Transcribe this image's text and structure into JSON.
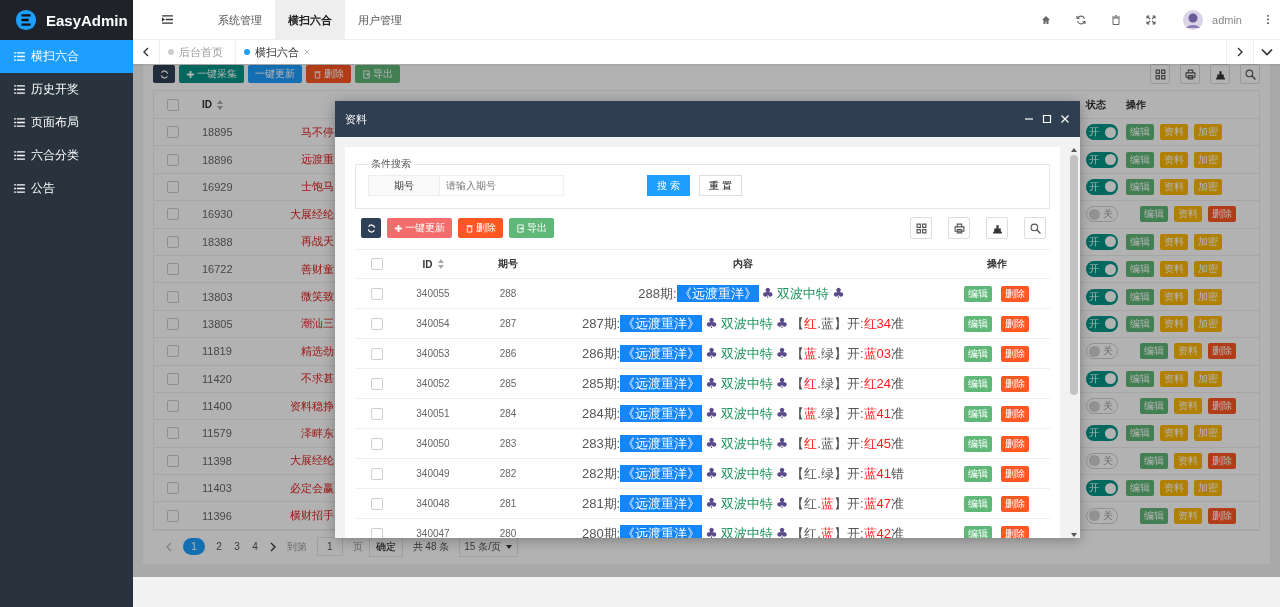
{
  "app": {
    "name": "EasyAdmin"
  },
  "top_menu": [
    {
      "label": "系统管理",
      "selected": false
    },
    {
      "label": "横扫六合",
      "selected": true
    },
    {
      "label": "用户管理",
      "selected": false
    }
  ],
  "user": {
    "name": "admin"
  },
  "sidebar": {
    "items": [
      {
        "label": "横扫六合",
        "selected": true
      },
      {
        "label": "历史开奖",
        "selected": false
      },
      {
        "label": "页面布局",
        "selected": false
      },
      {
        "label": "六合分类",
        "selected": false
      },
      {
        "label": "公告",
        "selected": false
      }
    ]
  },
  "page_tabs": [
    {
      "label": "后台首页",
      "selected": false,
      "closable": false
    },
    {
      "label": "横扫六合",
      "selected": true,
      "closable": true
    }
  ],
  "toolbar": [
    {
      "label": "一键采集",
      "kind": "add"
    },
    {
      "label": "一键更新",
      "kind": "update"
    },
    {
      "label": "删除",
      "kind": "delete"
    },
    {
      "label": "导出",
      "kind": "export"
    }
  ],
  "table": {
    "columns": [
      "ID",
      "状态",
      "操作"
    ],
    "all_checked": false,
    "rows": [
      {
        "checked": false,
        "id": "18895",
        "title": "马不停",
        "on": true,
        "switch_label": "开",
        "actions": [
          {
            "label": "编辑",
            "kind": "edit"
          },
          {
            "label": "资料",
            "kind": "info"
          },
          {
            "label": "加密",
            "kind": "info"
          }
        ]
      },
      {
        "checked": false,
        "id": "18896",
        "title": "远渡重",
        "on": true,
        "switch_label": "开",
        "actions": [
          {
            "label": "编辑",
            "kind": "edit"
          },
          {
            "label": "资料",
            "kind": "info"
          },
          {
            "label": "加密",
            "kind": "info"
          }
        ]
      },
      {
        "checked": false,
        "id": "16929",
        "title": "士饱马",
        "on": true,
        "switch_label": "开",
        "actions": [
          {
            "label": "编辑",
            "kind": "edit"
          },
          {
            "label": "资料",
            "kind": "info"
          },
          {
            "label": "加密",
            "kind": "info"
          }
        ]
      },
      {
        "checked": false,
        "id": "16930",
        "title": "大展经纶",
        "on": false,
        "switch_label": "关",
        "actions": [
          {
            "label": "编辑",
            "kind": "edit"
          },
          {
            "label": "资料",
            "kind": "info"
          },
          {
            "label": "删除",
            "kind": "delete"
          }
        ]
      },
      {
        "checked": false,
        "id": "18388",
        "title": "再战天",
        "on": true,
        "switch_label": "开",
        "actions": [
          {
            "label": "编辑",
            "kind": "edit"
          },
          {
            "label": "资料",
            "kind": "info"
          },
          {
            "label": "加密",
            "kind": "info"
          }
        ]
      },
      {
        "checked": false,
        "id": "16722",
        "title": "善财童",
        "on": true,
        "switch_label": "开",
        "actions": [
          {
            "label": "编辑",
            "kind": "edit"
          },
          {
            "label": "资料",
            "kind": "info"
          },
          {
            "label": "加密",
            "kind": "info"
          }
        ]
      },
      {
        "checked": false,
        "id": "13803",
        "title": "微笑致",
        "on": true,
        "switch_label": "开",
        "actions": [
          {
            "label": "编辑",
            "kind": "edit"
          },
          {
            "label": "资料",
            "kind": "info"
          },
          {
            "label": "加密",
            "kind": "info"
          }
        ]
      },
      {
        "checked": false,
        "id": "13805",
        "title": "潮汕三",
        "on": true,
        "switch_label": "开",
        "actions": [
          {
            "label": "编辑",
            "kind": "edit"
          },
          {
            "label": "资料",
            "kind": "info"
          },
          {
            "label": "加密",
            "kind": "info"
          }
        ]
      },
      {
        "checked": false,
        "id": "11819",
        "title": "精选劲",
        "on": false,
        "switch_label": "关",
        "actions": [
          {
            "label": "编辑",
            "kind": "edit"
          },
          {
            "label": "资料",
            "kind": "info"
          },
          {
            "label": "删除",
            "kind": "delete"
          }
        ]
      },
      {
        "checked": false,
        "id": "11420",
        "title": "不求甚",
        "on": true,
        "switch_label": "开",
        "actions": [
          {
            "label": "编辑",
            "kind": "edit"
          },
          {
            "label": "资料",
            "kind": "info"
          },
          {
            "label": "加密",
            "kind": "info"
          }
        ]
      },
      {
        "checked": false,
        "id": "11400",
        "title": "资料稳挣",
        "on": false,
        "switch_label": "关",
        "actions": [
          {
            "label": "编辑",
            "kind": "edit"
          },
          {
            "label": "资料",
            "kind": "info"
          },
          {
            "label": "删除",
            "kind": "delete"
          }
        ]
      },
      {
        "checked": false,
        "id": "11579",
        "title": "泽畔东",
        "on": true,
        "switch_label": "开",
        "actions": [
          {
            "label": "编辑",
            "kind": "edit"
          },
          {
            "label": "资料",
            "kind": "info"
          },
          {
            "label": "加密",
            "kind": "info"
          }
        ]
      },
      {
        "checked": false,
        "id": "11398",
        "title": "大展经纶",
        "on": false,
        "switch_label": "关",
        "actions": [
          {
            "label": "编辑",
            "kind": "edit"
          },
          {
            "label": "资料",
            "kind": "info"
          },
          {
            "label": "删除",
            "kind": "delete"
          }
        ]
      },
      {
        "checked": false,
        "id": "11403",
        "title": "必定会赢",
        "on": true,
        "switch_label": "开",
        "actions": [
          {
            "label": "编辑",
            "kind": "edit"
          },
          {
            "label": "资料",
            "kind": "info"
          },
          {
            "label": "加密",
            "kind": "info"
          }
        ]
      },
      {
        "checked": false,
        "id": "11396",
        "title": "横财招手",
        "on": false,
        "switch_label": "关",
        "actions": [
          {
            "label": "编辑",
            "kind": "edit"
          },
          {
            "label": "资料",
            "kind": "info"
          },
          {
            "label": "删除",
            "kind": "delete"
          }
        ]
      }
    ]
  },
  "pagination": {
    "pages": [
      {
        "label": "1",
        "selected": true
      },
      {
        "label": "2",
        "selected": false
      },
      {
        "label": "3",
        "selected": false
      },
      {
        "label": "4",
        "selected": false
      }
    ],
    "goto_label": "到第",
    "goto_value": "1",
    "page_unit": "页",
    "confirm": "确定",
    "total": "共 48 条",
    "page_size": "15 条/页"
  },
  "modal": {
    "title": "资料",
    "search": {
      "legend": "条件搜索",
      "field_label": "期号",
      "placeholder": "请输入期号",
      "search_button": "搜 索",
      "reset_button": "重 置"
    },
    "toolbar": [
      {
        "label": "一键更新",
        "kind": "add-danger"
      },
      {
        "label": "删除",
        "kind": "delete"
      },
      {
        "label": "导出",
        "kind": "export"
      }
    ],
    "columns": [
      "ID",
      "期号",
      "内容",
      "操作"
    ],
    "all_checked": false,
    "rows": [
      {
        "checked": false,
        "id": "340055",
        "period": "288",
        "content": [
          {
            "text": "288期:",
            "kind": "plain"
          },
          {
            "text": "《远渡重洋》",
            "kind": "tag"
          },
          {
            "text": "♣",
            "kind": "suit"
          },
          {
            "text": "双波中特",
            "kind": "tip"
          },
          {
            "text": "♣",
            "kind": "suit"
          }
        ],
        "actions": [
          {
            "label": "编辑",
            "kind": "edit"
          },
          {
            "label": "删除",
            "kind": "delete"
          }
        ]
      },
      {
        "checked": false,
        "id": "340054",
        "period": "287",
        "content": [
          {
            "text": "287期:",
            "kind": "plain"
          },
          {
            "text": "《远渡重洋》",
            "kind": "tag"
          },
          {
            "text": "♣",
            "kind": "suit"
          },
          {
            "text": "双波中特",
            "kind": "tip"
          },
          {
            "text": "♣",
            "kind": "suit"
          },
          {
            "text": "【",
            "kind": "plain"
          },
          {
            "text": "红",
            "kind": "hit"
          },
          {
            "text": ".蓝】开:",
            "kind": "plain"
          },
          {
            "text": "红34",
            "kind": "hit"
          },
          {
            "text": "准",
            "kind": "plain"
          }
        ],
        "actions": [
          {
            "label": "编辑",
            "kind": "edit"
          },
          {
            "label": "删除",
            "kind": "delete"
          }
        ]
      },
      {
        "checked": false,
        "id": "340053",
        "period": "286",
        "content": [
          {
            "text": "286期:",
            "kind": "plain"
          },
          {
            "text": "《远渡重洋》",
            "kind": "tag"
          },
          {
            "text": "♣",
            "kind": "suit"
          },
          {
            "text": "双波中特",
            "kind": "tip"
          },
          {
            "text": "♣",
            "kind": "suit"
          },
          {
            "text": "【",
            "kind": "plain"
          },
          {
            "text": "蓝",
            "kind": "hit"
          },
          {
            "text": ".绿】开:",
            "kind": "plain"
          },
          {
            "text": "蓝03",
            "kind": "hit"
          },
          {
            "text": "准",
            "kind": "plain"
          }
        ],
        "actions": [
          {
            "label": "编辑",
            "kind": "edit"
          },
          {
            "label": "删除",
            "kind": "delete"
          }
        ]
      },
      {
        "checked": false,
        "id": "340052",
        "period": "285",
        "content": [
          {
            "text": "285期:",
            "kind": "plain"
          },
          {
            "text": "《远渡重洋》",
            "kind": "tag"
          },
          {
            "text": "♣",
            "kind": "suit"
          },
          {
            "text": "双波中特",
            "kind": "tip"
          },
          {
            "text": "♣",
            "kind": "suit"
          },
          {
            "text": "【",
            "kind": "plain"
          },
          {
            "text": "红",
            "kind": "hit"
          },
          {
            "text": ".绿】开:",
            "kind": "plain"
          },
          {
            "text": "红24",
            "kind": "hit"
          },
          {
            "text": "准",
            "kind": "plain"
          }
        ],
        "actions": [
          {
            "label": "编辑",
            "kind": "edit"
          },
          {
            "label": "删除",
            "kind": "delete"
          }
        ]
      },
      {
        "checked": false,
        "id": "340051",
        "period": "284",
        "content": [
          {
            "text": "284期:",
            "kind": "plain"
          },
          {
            "text": "《远渡重洋》",
            "kind": "tag"
          },
          {
            "text": "♣",
            "kind": "suit"
          },
          {
            "text": "双波中特",
            "kind": "tip"
          },
          {
            "text": "♣",
            "kind": "suit"
          },
          {
            "text": "【",
            "kind": "plain"
          },
          {
            "text": "蓝",
            "kind": "hit"
          },
          {
            "text": ".绿】开:",
            "kind": "plain"
          },
          {
            "text": "蓝41",
            "kind": "hit"
          },
          {
            "text": "准",
            "kind": "plain"
          }
        ],
        "actions": [
          {
            "label": "编辑",
            "kind": "edit"
          },
          {
            "label": "删除",
            "kind": "delete"
          }
        ]
      },
      {
        "checked": false,
        "id": "340050",
        "period": "283",
        "content": [
          {
            "text": "283期:",
            "kind": "plain"
          },
          {
            "text": "《远渡重洋》",
            "kind": "tag"
          },
          {
            "text": "♣",
            "kind": "suit"
          },
          {
            "text": "双波中特",
            "kind": "tip"
          },
          {
            "text": "♣",
            "kind": "suit"
          },
          {
            "text": "【",
            "kind": "plain"
          },
          {
            "text": "红",
            "kind": "hit"
          },
          {
            "text": ".蓝】开:",
            "kind": "plain"
          },
          {
            "text": "红45",
            "kind": "hit"
          },
          {
            "text": "准",
            "kind": "plain"
          }
        ],
        "actions": [
          {
            "label": "编辑",
            "kind": "edit"
          },
          {
            "label": "删除",
            "kind": "delete"
          }
        ]
      },
      {
        "checked": false,
        "id": "340049",
        "period": "282",
        "content": [
          {
            "text": "282期:",
            "kind": "plain"
          },
          {
            "text": "《远渡重洋》",
            "kind": "tag"
          },
          {
            "text": "♣",
            "kind": "suit"
          },
          {
            "text": "双波中特",
            "kind": "tip"
          },
          {
            "text": "♣",
            "kind": "suit"
          },
          {
            "text": "【红.绿】开:",
            "kind": "plain"
          },
          {
            "text": "蓝41",
            "kind": "hit"
          },
          {
            "text": "错",
            "kind": "plain"
          }
        ],
        "actions": [
          {
            "label": "编辑",
            "kind": "edit"
          },
          {
            "label": "删除",
            "kind": "delete"
          }
        ]
      },
      {
        "checked": false,
        "id": "340048",
        "period": "281",
        "content": [
          {
            "text": "281期:",
            "kind": "plain"
          },
          {
            "text": "《远渡重洋》",
            "kind": "tag"
          },
          {
            "text": "♣",
            "kind": "suit"
          },
          {
            "text": "双波中特",
            "kind": "tip"
          },
          {
            "text": "♣",
            "kind": "suit"
          },
          {
            "text": "【红.",
            "kind": "plain"
          },
          {
            "text": "蓝",
            "kind": "hit"
          },
          {
            "text": "】开:",
            "kind": "plain"
          },
          {
            "text": "蓝47",
            "kind": "hit"
          },
          {
            "text": "准",
            "kind": "plain"
          }
        ],
        "actions": [
          {
            "label": "编辑",
            "kind": "edit"
          },
          {
            "label": "删除",
            "kind": "delete"
          }
        ]
      },
      {
        "checked": false,
        "id": "340047",
        "period": "280",
        "content": [
          {
            "text": "280期:",
            "kind": "plain"
          },
          {
            "text": "《远渡重洋》",
            "kind": "tag"
          },
          {
            "text": "♣",
            "kind": "suit"
          },
          {
            "text": "双波中特",
            "kind": "tip"
          },
          {
            "text": "♣",
            "kind": "suit"
          },
          {
            "text": "【红.",
            "kind": "plain"
          },
          {
            "text": "蓝",
            "kind": "hit"
          },
          {
            "text": "】开:",
            "kind": "plain"
          },
          {
            "text": "蓝42",
            "kind": "hit"
          },
          {
            "text": "准",
            "kind": "plain"
          }
        ],
        "actions": [
          {
            "label": "编辑",
            "kind": "edit"
          },
          {
            "label": "删除",
            "kind": "delete"
          }
        ]
      }
    ]
  }
}
